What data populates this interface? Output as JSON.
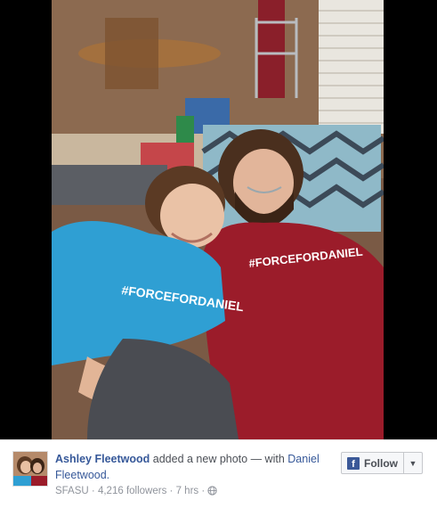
{
  "post": {
    "author": "Ashley Fleetwood",
    "action": "added a new photo — with",
    "tagged": "Daniel Fleetwood.",
    "network": "SFASU",
    "separator": "·",
    "followers": "4,216 followers",
    "time": "7 hrs",
    "audience_icon": "globe-icon"
  },
  "follow": {
    "label": "Follow",
    "icon": "facebook-logo-icon",
    "caret_icon": "caret-down-icon",
    "caret_glyph": "▼"
  },
  "photo": {
    "shirt_text_left": "#FORCEFORDANIEL",
    "shirt_text_right": "#FORCEFORDANIEL"
  },
  "colors": {
    "link": "#365899",
    "muted": "#90949c",
    "facebook_blue": "#3b5998"
  }
}
